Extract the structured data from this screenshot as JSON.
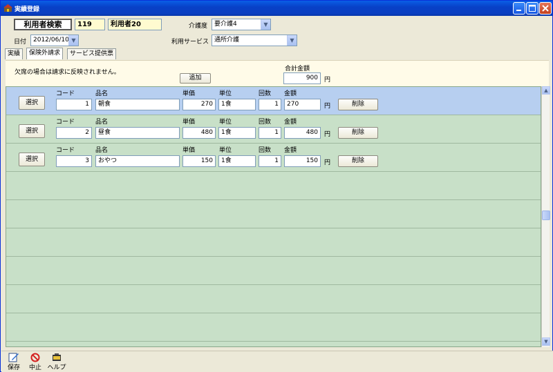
{
  "window": {
    "title": "実績登録"
  },
  "header": {
    "search_button": "利用者検索",
    "user_id": "119",
    "user_name": "利用者20",
    "care_level_label": "介護度",
    "care_level_value": "要介護4",
    "date_label": "日付",
    "date_value": "2012/06/10",
    "service_label": "利用サービス",
    "service_value": "通所介護"
  },
  "tabs": [
    {
      "label": "実績"
    },
    {
      "label": "保険外請求"
    },
    {
      "label": "サービス提供票"
    }
  ],
  "notice": {
    "message": "欠席の場合は請求に反映されません。",
    "add_button": "追加",
    "total_label": "合計金額",
    "total_value": "900",
    "total_unit": "円"
  },
  "columns": {
    "code": "コード",
    "item": "品名",
    "price": "単価",
    "unit": "単位",
    "count": "回数",
    "amount": "金額"
  },
  "rows": [
    {
      "select": "選択",
      "code": "1",
      "item": "朝食",
      "price": "270",
      "unit": "1食",
      "count": "1",
      "amount": "270",
      "yen": "円",
      "delete": "削除"
    },
    {
      "select": "選択",
      "code": "2",
      "item": "昼食",
      "price": "480",
      "unit": "1食",
      "count": "1",
      "amount": "480",
      "yen": "円",
      "delete": "削除"
    },
    {
      "select": "選択",
      "code": "3",
      "item": "おやつ",
      "price": "150",
      "unit": "1食",
      "count": "1",
      "amount": "150",
      "yen": "円",
      "delete": "削除"
    }
  ],
  "toolbar": {
    "save": "保存",
    "cancel": "中止",
    "help": "ヘルプ"
  },
  "colors": {
    "title_bar": "#0a5fe6",
    "selected_row": "#b7cff0",
    "list_row": "#c8e0c8",
    "notice_bg": "#fffbe8"
  }
}
